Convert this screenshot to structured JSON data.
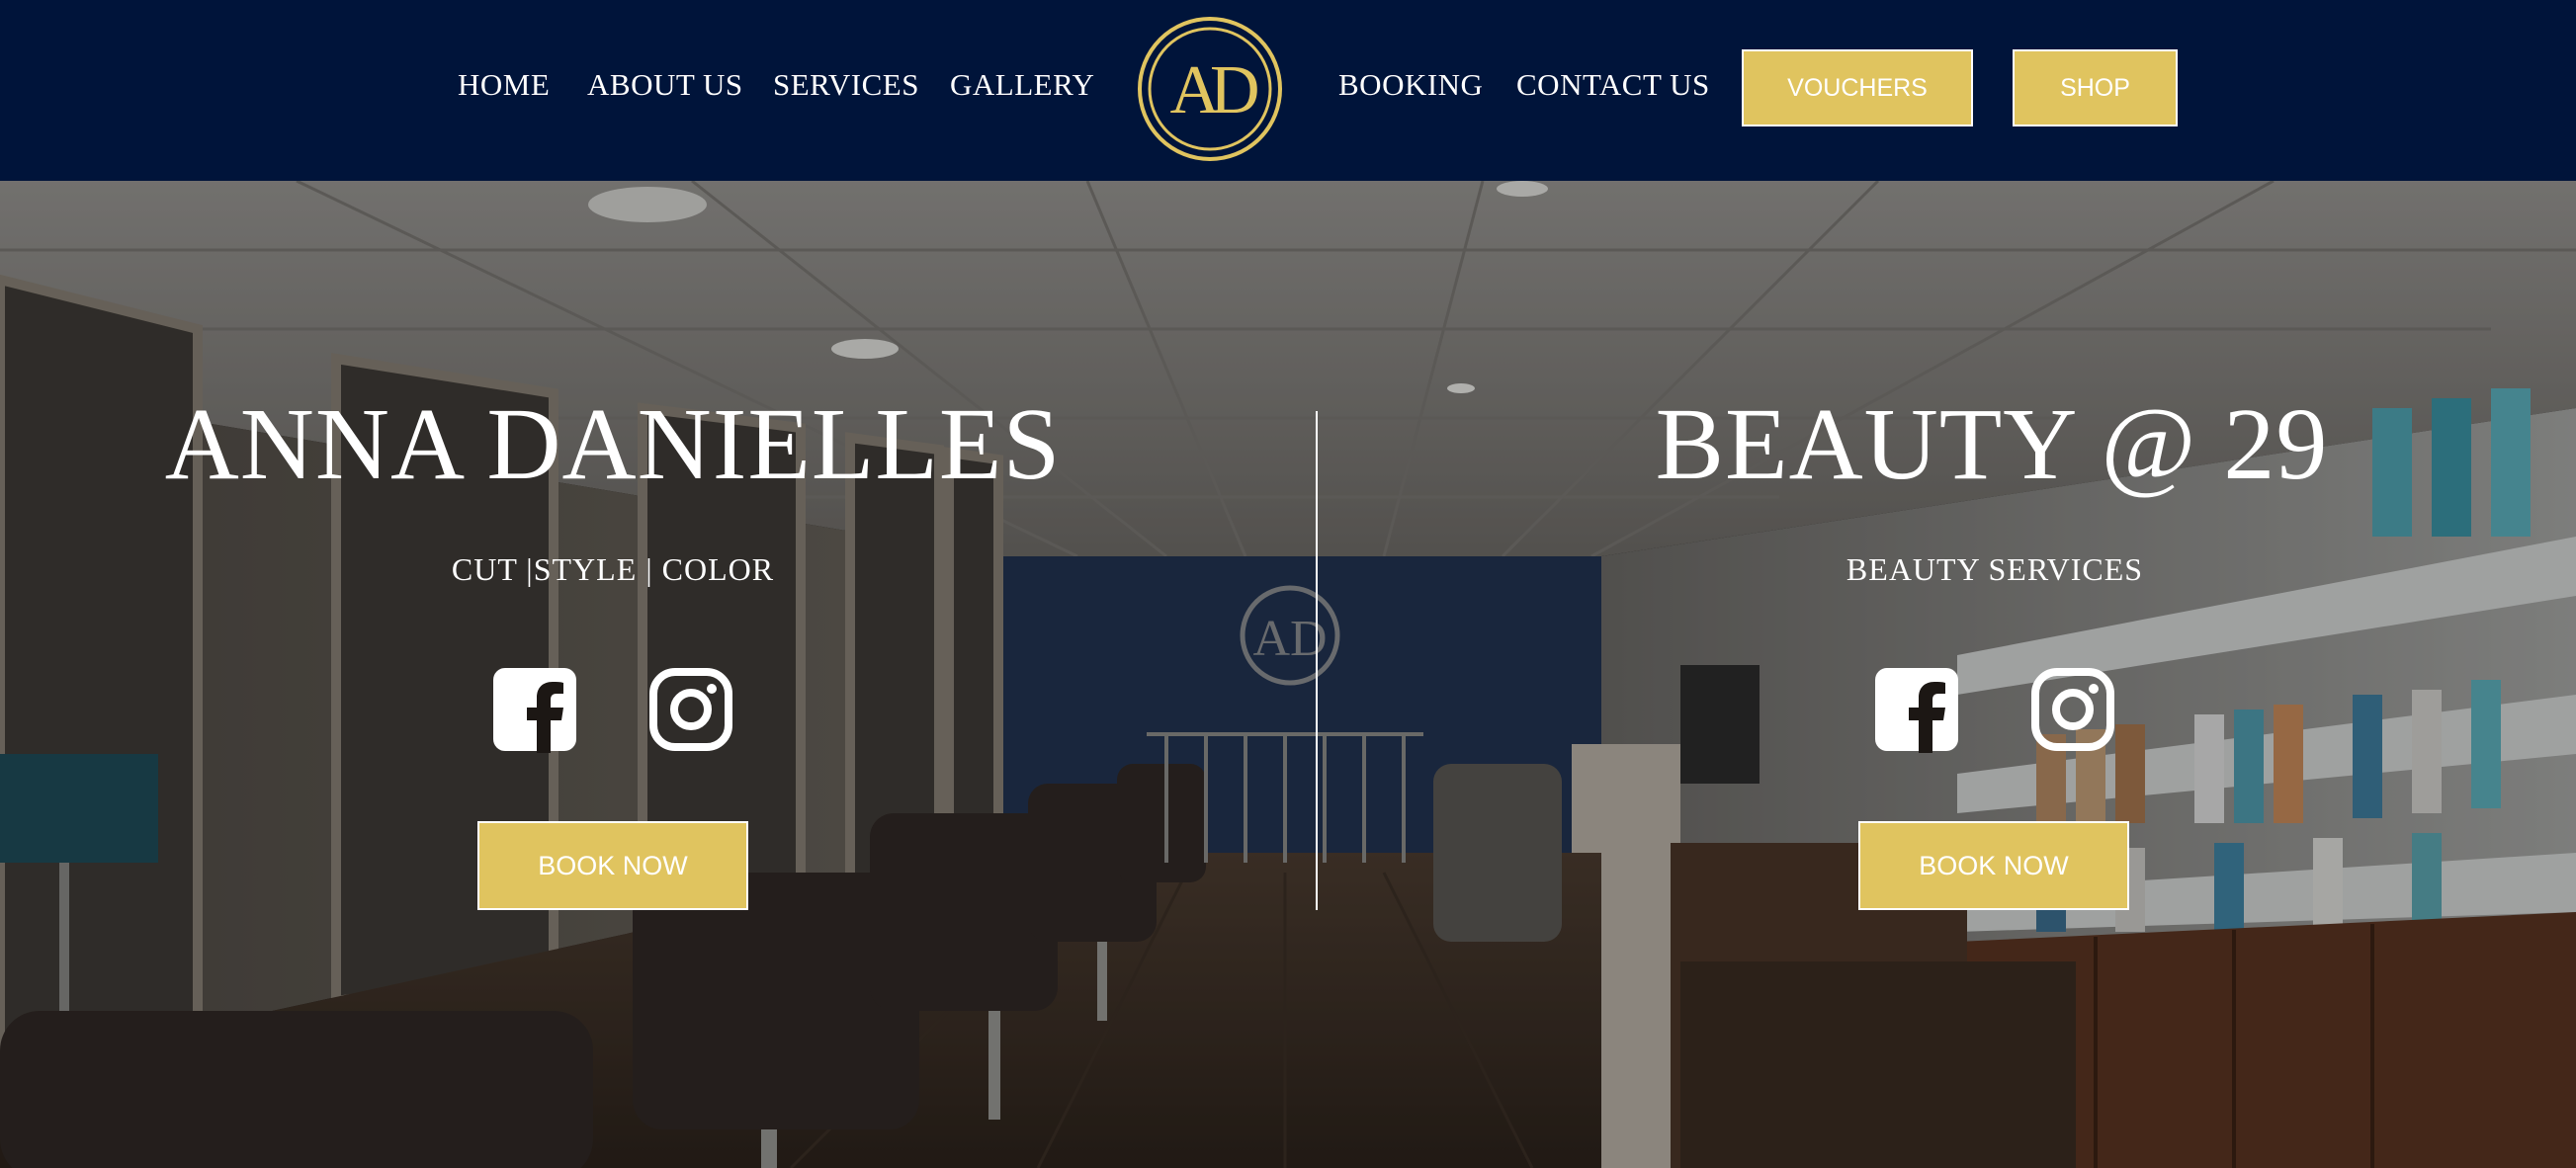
{
  "nav": {
    "links_left": [
      "HOME",
      "ABOUT US",
      "SERVICES",
      "GALLERY"
    ],
    "links_right": [
      "BOOKING",
      "CONTACT US"
    ],
    "logo_text": "AD",
    "vouchers_label": "VOUCHERS",
    "shop_label": "SHOP"
  },
  "hero": {
    "left": {
      "title": "ANNA DANIELLES",
      "subtitle": "CUT  |STYLE  |  COLOR",
      "book_label": "BOOK NOW",
      "social_icons": [
        "facebook-icon",
        "instagram-icon"
      ]
    },
    "right": {
      "title": "BEAUTY @ 29",
      "subtitle": "BEAUTY SERVICES",
      "book_label": "BOOK NOW",
      "social_icons": [
        "facebook-icon",
        "instagram-icon"
      ]
    },
    "background_logo_text": "AD"
  },
  "colors": {
    "nav_bg": "#00143a",
    "accent_gold": "#e0c45f",
    "text": "#ffffff"
  }
}
